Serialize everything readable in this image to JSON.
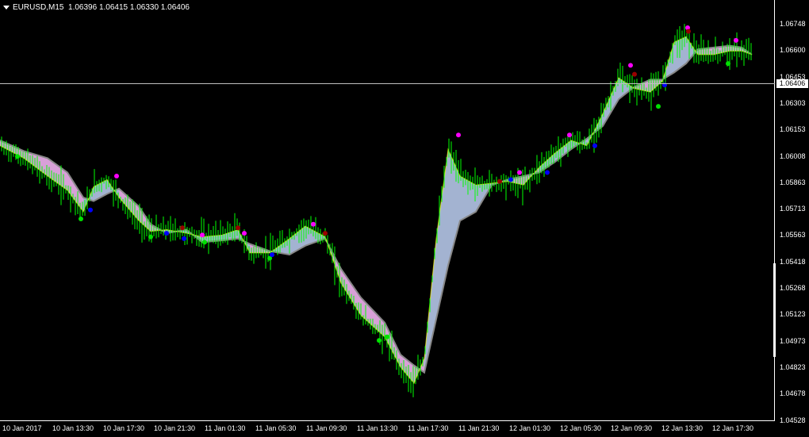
{
  "header": {
    "symbol": "EURUSD,M15",
    "ohlc": "1.06396 1.06415 1.06330 1.06406"
  },
  "current_price": "1.06406",
  "y_axis": {
    "labels": [
      "1.06748",
      "1.06600",
      "1.06453",
      "1.06303",
      "1.06153",
      "1.06008",
      "1.05863",
      "1.05713",
      "1.05563",
      "1.05418",
      "1.05268",
      "1.05123",
      "1.04973",
      "1.04823",
      "1.04678",
      "1.04528"
    ]
  },
  "x_axis": {
    "labels": [
      "10 Jan 2017",
      "10 Jan 13:30",
      "10 Jan 17:30",
      "10 Jan 21:30",
      "11 Jan 01:30",
      "11 Jan 05:30",
      "11 Jan 09:30",
      "11 Jan 13:30",
      "11 Jan 17:30",
      "11 Jan 21:30",
      "12 Jan 01:30",
      "12 Jan 05:30",
      "12 Jan 09:30",
      "12 Jan 13:30",
      "12 Jan 17:30"
    ]
  },
  "colors": {
    "background": "#000000",
    "candles": "#00ff00",
    "cloud_up": "#a3b3d1",
    "cloud_down": "#d8a0d8",
    "ma_line": "#ffff00",
    "dot_green": "#00e000",
    "dot_magenta": "#ff00ff",
    "dot_blue": "#0000ff",
    "dot_darkred": "#990000"
  },
  "chart_data": {
    "type": "line",
    "title": "EURUSD,M15",
    "xlabel": "",
    "ylabel": "",
    "ylim": [
      1.04528,
      1.06748
    ],
    "x": [
      "10 Jan 2017",
      "10 Jan 13:30",
      "10 Jan 17:30",
      "10 Jan 21:30",
      "11 Jan 01:30",
      "11 Jan 05:30",
      "11 Jan 09:30",
      "11 Jan 13:30",
      "11 Jan 17:30",
      "11 Jan 21:30",
      "12 Jan 01:30",
      "12 Jan 05:30",
      "12 Jan 09:30",
      "12 Jan 13:30",
      "12 Jan 17:30"
    ],
    "series": [
      {
        "values": [
          1.0603,
          1.0583,
          1.0585,
          1.0563,
          1.056,
          1.0545,
          1.0565,
          1.051,
          1.047,
          1.059,
          1.059,
          1.0608,
          1.065,
          1.064,
          1.0665,
          1.064
        ]
      }
    ]
  }
}
